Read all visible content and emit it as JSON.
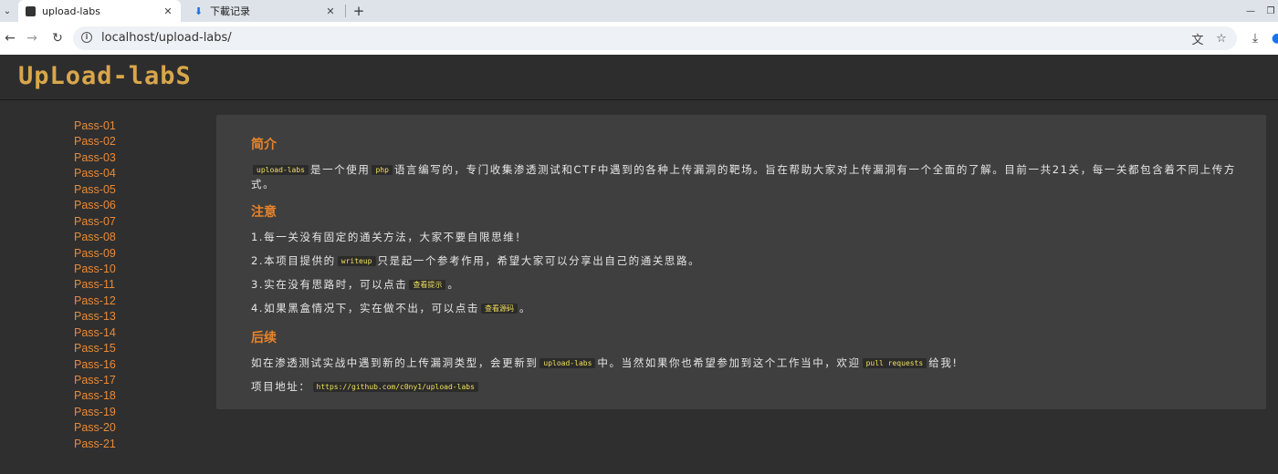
{
  "browser": {
    "tabs": [
      {
        "title": "upload-labs"
      },
      {
        "title": "下載记录"
      }
    ],
    "address": "localhost/upload-labs/"
  },
  "site": {
    "logo": "UpLoad-labS"
  },
  "sidebar": {
    "items": [
      "Pass-01",
      "Pass-02",
      "Pass-03",
      "Pass-04",
      "Pass-05",
      "Pass-06",
      "Pass-07",
      "Pass-08",
      "Pass-09",
      "Pass-10",
      "Pass-11",
      "Pass-12",
      "Pass-13",
      "Pass-14",
      "Pass-15",
      "Pass-16",
      "Pass-17",
      "Pass-18",
      "Pass-19",
      "Pass-20",
      "Pass-21"
    ]
  },
  "content": {
    "intro": {
      "heading": "简介",
      "code1": "upload-labs",
      "t1": "是一个使用",
      "code2": "php",
      "t2": "语言编写的，专门收集渗透测试和CTF中遇到的各种上传漏洞的靶场。旨在帮助大家对上传漏洞有一个全面的了解。目前一共21关，每一关都包含着不同上传方式。"
    },
    "notes": {
      "heading": "注意",
      "n1": "1.每一关没有固定的通关方法，大家不要自限思维！",
      "n2_a": "2.本项目提供的",
      "n2_code": "writeup",
      "n2_b": "只是起一个参考作用，希望大家可以分享出自己的通关思路。",
      "n3_a": "3.实在没有思路时，可以点击",
      "n3_code": "查看提示",
      "n3_b": "。",
      "n4_a": "4.如果黑盒情况下，实在做不出，可以点击",
      "n4_code": "查看源码",
      "n4_b": "。"
    },
    "after": {
      "heading": "后续",
      "a_1": "如在渗透测试实战中遇到新的上传漏洞类型，会更新到",
      "a_code1": "upload-labs",
      "a_2": "中。当然如果你也希望参加到这个工作当中，欢迎",
      "a_code2": "pull requests",
      "a_3": "给我!",
      "addr_label": "项目地址：",
      "addr_code": "https://github.com/c0ny1/upload-labs"
    }
  }
}
